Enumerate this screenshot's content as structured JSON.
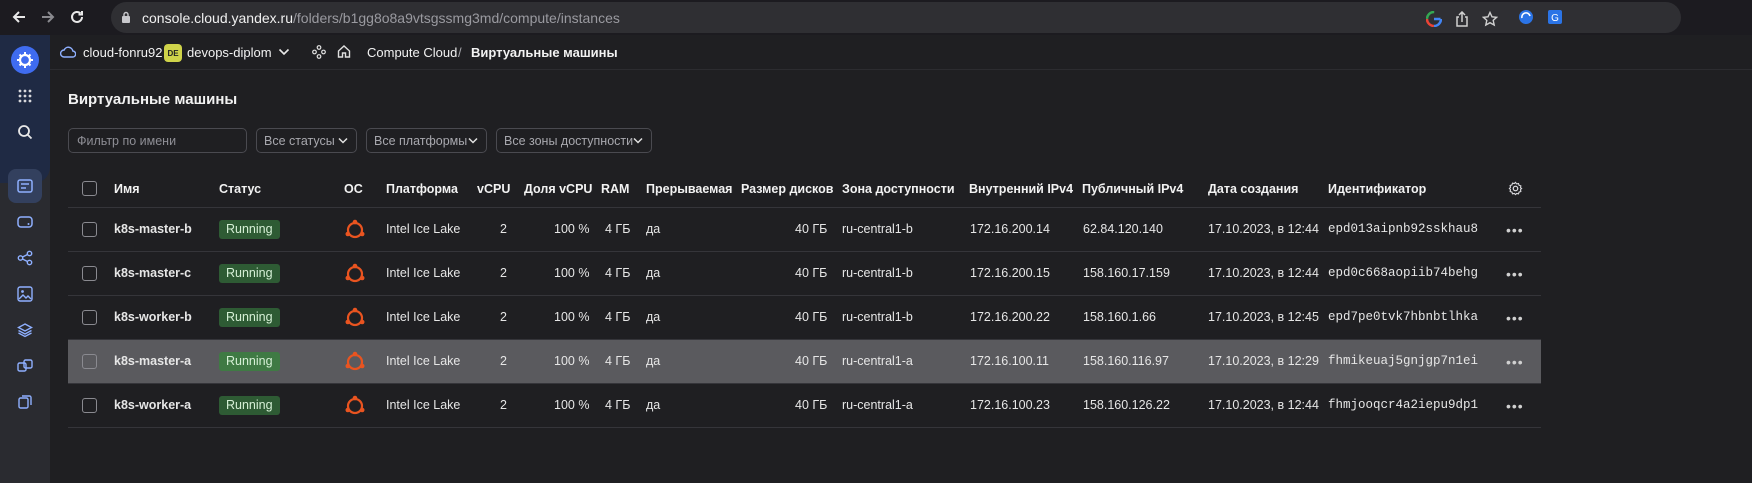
{
  "browser": {
    "url_host": "console.cloud.yandex.ru",
    "url_path": "/folders/b1gg8o8a9vtsgssmg3md/compute/instances"
  },
  "appbar": {
    "cloud": "cloud-fonru92",
    "folder_badge": "DE",
    "folder": "devops-diplom",
    "service": "Compute Cloud",
    "separator": "/",
    "current": "Виртуальные машины"
  },
  "page": {
    "title": "Виртуальные машины"
  },
  "filters": {
    "name_placeholder": "Фильтр по имени",
    "status": "Все статусы",
    "platform": "Все платформы",
    "zone": "Все зоны доступности"
  },
  "table": {
    "headers": {
      "name": "Имя",
      "status": "Статус",
      "os": "ОС",
      "platform": "Платформа",
      "vcpu": "vCPU",
      "vcpu_share": "Доля vCPU",
      "ram": "RAM",
      "preemptible": "Прерываемая",
      "disk_size": "Размер дисков",
      "zone": "Зона доступности",
      "internal_ip": "Внутренний IPv4",
      "public_ip": "Публичный IPv4",
      "created": "Дата создания",
      "id": "Идентификатор"
    },
    "rows": [
      {
        "name": "k8s-master-b",
        "status": "Running",
        "platform": "Intel Ice Lake",
        "vcpu": "2",
        "vcpu_share": "100 %",
        "ram": "4 ГБ",
        "preemptible": "да",
        "disk": "40 ГБ",
        "zone": "ru-central1-b",
        "internal_ip": "172.16.200.14",
        "public_ip": "62.84.120.140",
        "created": "17.10.2023, в 12:44",
        "id": "epd013aipnb92sskhau8"
      },
      {
        "name": "k8s-master-c",
        "status": "Running",
        "platform": "Intel Ice Lake",
        "vcpu": "2",
        "vcpu_share": "100 %",
        "ram": "4 ГБ",
        "preemptible": "да",
        "disk": "40 ГБ",
        "zone": "ru-central1-b",
        "internal_ip": "172.16.200.15",
        "public_ip": "158.160.17.159",
        "created": "17.10.2023, в 12:44",
        "id": "epd0c668aopiib74behg"
      },
      {
        "name": "k8s-worker-b",
        "status": "Running",
        "platform": "Intel Ice Lake",
        "vcpu": "2",
        "vcpu_share": "100 %",
        "ram": "4 ГБ",
        "preemptible": "да",
        "disk": "40 ГБ",
        "zone": "ru-central1-b",
        "internal_ip": "172.16.200.22",
        "public_ip": "158.160.1.66",
        "created": "17.10.2023, в 12:45",
        "id": "epd7pe0tvk7hbnbtlhka"
      },
      {
        "name": "k8s-master-a",
        "status": "Running",
        "platform": "Intel Ice Lake",
        "vcpu": "2",
        "vcpu_share": "100 %",
        "ram": "4 ГБ",
        "preemptible": "да",
        "disk": "40 ГБ",
        "zone": "ru-central1-a",
        "internal_ip": "172.16.100.11",
        "public_ip": "158.160.116.97",
        "created": "17.10.2023, в 12:29",
        "id": "fhmikeuaj5gnjgp7n1ei"
      },
      {
        "name": "k8s-worker-a",
        "status": "Running",
        "platform": "Intel Ice Lake",
        "vcpu": "2",
        "vcpu_share": "100 %",
        "ram": "4 ГБ",
        "preemptible": "да",
        "disk": "40 ГБ",
        "zone": "ru-central1-a",
        "internal_ip": "172.16.100.23",
        "public_ip": "158.160.126.22",
        "created": "17.10.2023, в 12:44",
        "id": "fhmjooqcr4a2iepu9dp1"
      }
    ]
  },
  "colors": {
    "accent": "#3f6cf0",
    "running_bg": "#2e5b34",
    "ubuntu": "#e95420"
  }
}
